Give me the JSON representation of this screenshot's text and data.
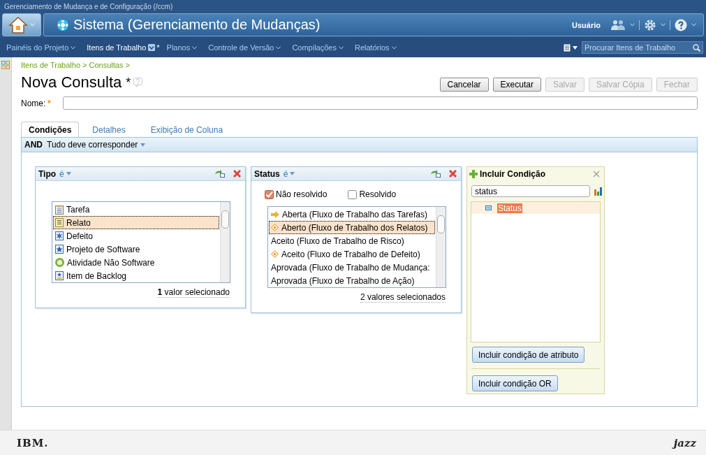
{
  "app_title": "Gerenciamento de Mudança e de Configuração (/ccm)",
  "header": {
    "title": "Sistema (Gerenciamento de Mudanças)",
    "user": "Usuário"
  },
  "nav": {
    "items": [
      {
        "label": "Painéis do Projeto",
        "selected": false
      },
      {
        "label": "Itens de Trabalho",
        "selected": true,
        "mark": "*"
      },
      {
        "label": "Planos",
        "selected": false
      },
      {
        "label": "Controle de Versão",
        "selected": false
      },
      {
        "label": "Compilações",
        "selected": false
      },
      {
        "label": "Relatórios",
        "selected": false
      }
    ],
    "search": {
      "placeholder": "Procurar Itens de Trabalho"
    }
  },
  "breadcrumb": [
    {
      "label": "Itens de Trabalho",
      "separator": ">"
    },
    {
      "label": "Consultas",
      "separator": ">"
    }
  ],
  "page": {
    "title": "Nova Consulta",
    "modified_mark": "*"
  },
  "buttons": [
    {
      "label": "Cancelar",
      "disabled": false
    },
    {
      "label": "Executar",
      "disabled": false
    },
    {
      "label": "Salvar",
      "disabled": true
    },
    {
      "label": "Salvar Cópia",
      "disabled": true
    },
    {
      "label": "Fechar",
      "disabled": true
    }
  ],
  "name_field": {
    "label": "Nome:",
    "required_mark": "*"
  },
  "tabs": [
    {
      "label": "Condições",
      "selected": true
    },
    {
      "label": "Detalhes",
      "selected": false
    },
    {
      "label": "Exibição de Coluna",
      "selected": false
    }
  ],
  "conditions": {
    "operator": "AND",
    "match": "Tudo deve corresponder",
    "cards": [
      {
        "attribute": "Tipo",
        "operator": "é",
        "values": [
          {
            "label": "Tarefa",
            "kind": "task",
            "selected": false
          },
          {
            "label": "Relato",
            "kind": "story",
            "selected": true
          },
          {
            "label": "Defeito",
            "kind": "defect",
            "selected": false
          },
          {
            "label": "Projeto de Software",
            "kind": "project",
            "selected": false
          },
          {
            "label": "Atividade Não Software",
            "kind": "activity",
            "selected": false
          },
          {
            "label": "Item de Backlog",
            "kind": "backlog",
            "selected": false
          }
        ],
        "summary": "**1** valor selecionado"
      },
      {
        "attribute": "Status",
        "operator": "é",
        "options": [
          {
            "label": "Não resolvido",
            "checked": true
          },
          {
            "label": "Resolvido",
            "checked": false
          }
        ],
        "values": [
          {
            "label": "Aberta (Fluxo de Trabalho das Tarefas)",
            "kind": "arrow",
            "selected": false
          },
          {
            "label": "Aberto (Fluxo de Trabalho dos Relatos)",
            "kind": "diamond",
            "selected": true
          },
          {
            "label": "Aceito (Fluxo de Trabalho de Risco)",
            "kind": "plain",
            "selected": false
          },
          {
            "label": "Aceito (Fluxo de Trabalho de Defeito)",
            "kind": "diamond",
            "selected": false
          },
          {
            "label": "Aprovada (Fluxo de Trabalho de Mudança:",
            "kind": "plain",
            "selected": false
          },
          {
            "label": "Aprovada (Fluxo de Trabalho de Ação)",
            "kind": "plain",
            "selected": false
          }
        ],
        "summary": "2 valores selecionados"
      }
    ]
  },
  "add_condition": {
    "title": "Incluir Condição",
    "filter": "status",
    "tree": [
      {
        "label": "Status",
        "selected": true
      }
    ],
    "buttons": [
      "Incluir condição de atributo",
      "Incluir condição OR"
    ]
  },
  "footer": {
    "left_logo": "IBM.",
    "right_logo": "jazz"
  }
}
